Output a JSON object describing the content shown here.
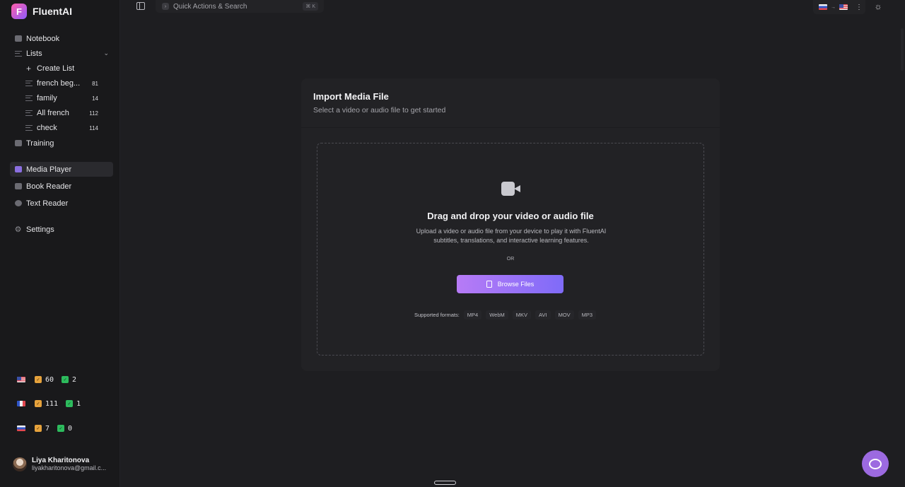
{
  "app": {
    "name": "FluentAI",
    "logo_letter": "F"
  },
  "nav": {
    "notebook": "Notebook",
    "lists": "Lists",
    "create_list": "Create List",
    "list_items": [
      {
        "label": "french beg...",
        "count": "81"
      },
      {
        "label": "family",
        "count": "14"
      },
      {
        "label": "All french",
        "count": "112"
      },
      {
        "label": "check",
        "count": "114"
      }
    ],
    "training": "Training",
    "media_player": "Media Player",
    "book_reader": "Book Reader",
    "text_reader": "Text Reader",
    "settings": "Settings"
  },
  "stats": [
    {
      "flag": "us",
      "orange": "60",
      "green": "2"
    },
    {
      "flag": "fr",
      "orange": "111",
      "green": "1"
    },
    {
      "flag": "ru",
      "orange": "7",
      "green": "0"
    }
  ],
  "user": {
    "name": "Liya Kharitonova",
    "email": "liyakharitonova@gmail.c..."
  },
  "topbar": {
    "search_placeholder": "Quick Actions & Search",
    "shortcut": "⌘ K",
    "lang_arrow": "→"
  },
  "card": {
    "title": "Import Media File",
    "subtitle": "Select a video or audio file to get started",
    "drop_title": "Drag and drop your video or audio file",
    "drop_desc": "Upload a video or audio file from your device to play it with FluentAI subtitles, translations, and interactive learning features.",
    "or": "OR",
    "browse": "Browse Files",
    "supported_label": "Supported formats:",
    "formats": [
      "MP4",
      "WebM",
      "MKV",
      "AVI",
      "MOV",
      "MP3"
    ]
  },
  "colors": {
    "accent_start": "#b77bf6",
    "accent_end": "#7f6bf8",
    "chat": "#9c6ae0"
  }
}
